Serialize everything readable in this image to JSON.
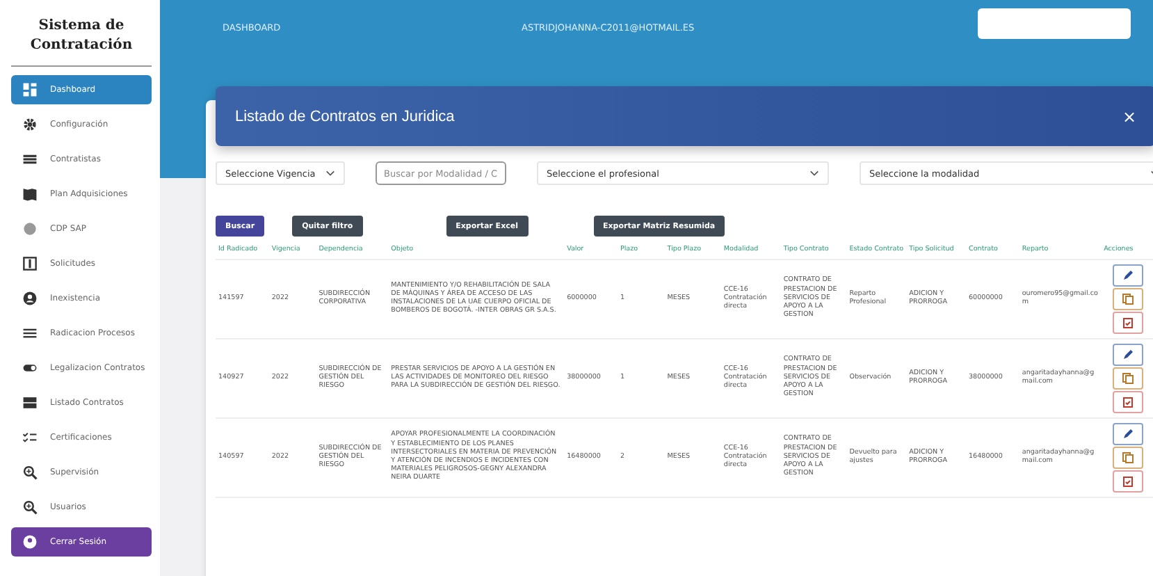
{
  "sidebar": {
    "title": "Sistema de Contratación",
    "items": [
      {
        "label": "Dashboard",
        "kind": "nav",
        "selected": true
      },
      {
        "label": "Configuración",
        "kind": "nav",
        "selected": false
      },
      {
        "label": "Contratistas",
        "kind": "nav",
        "selected": false
      },
      {
        "label": "Plan Adquisiciones",
        "kind": "nav",
        "selected": false
      },
      {
        "label": "CDP SAP",
        "kind": "nav",
        "selected": false
      },
      {
        "label": "Solicitudes",
        "kind": "nav",
        "selected": false
      },
      {
        "label": "Inexistencia",
        "kind": "nav",
        "selected": false
      },
      {
        "label": "Radicacion Procesos",
        "kind": "nav",
        "selected": false
      },
      {
        "label": "Legalizacion Contratos",
        "kind": "nav",
        "selected": false
      },
      {
        "label": "Listado Contratos",
        "kind": "nav",
        "selected": false
      },
      {
        "label": "Certificaciones",
        "kind": "nav",
        "selected": false
      },
      {
        "label": "Supervisión",
        "kind": "nav",
        "selected": false
      },
      {
        "label": "Usuarios",
        "kind": "nav",
        "selected": false
      },
      {
        "label": "Cerrar Sesión",
        "kind": "logout",
        "selected": false
      }
    ]
  },
  "top_bar": {
    "title": "DASHBOARD",
    "user": "ASTRIDJOHANNA-C2011@HOTMAIL.ES"
  },
  "panel": {
    "title": "Listado de Contratos en Juridica",
    "close": "×",
    "filters": {
      "vigencia": "Seleccione Vigencia",
      "search_placeholder": "Buscar por Modalidad / C",
      "profesional": "Seleccione el profesional",
      "modalidad": "Seleccione la modalidad"
    },
    "buttons": [
      {
        "label": "Buscar",
        "kind": "primary"
      },
      {
        "label": "Quitar filtro",
        "kind": "dark"
      },
      {
        "label": "Exportar Excel",
        "kind": "dark"
      },
      {
        "label": "Exportar Matriz Resumida",
        "kind": "dark"
      }
    ],
    "table": {
      "columns": [
        "Id Radicado",
        "Vigencia",
        "Dependencia",
        "Objeto",
        "Valor",
        "Plazo",
        "Tipo Plazo",
        "Modalidad",
        "Tipo Contrato",
        "Estado Contrato",
        "Tipo Solicitud",
        "Contrato",
        "Reparto",
        "Acciones"
      ],
      "rows": [
        {
          "cells": [
            "141597",
            "2022",
            "SUBDIRECCIÓN CORPORATIVA",
            "MANTENIMIENTO Y/O REHABILITACIÓN DE SALA DE MÁQUINAS Y ÁREA DE ACCESO DE LAS INSTALACIONES DE LA UAE CUERPO OFICIAL DE BOMBEROS DE BOGOTÁ. -INTER OBRAS GR S.A.S.",
            "6000000",
            "1",
            "MESES",
            "CCE-16 Contratación directa",
            "CONTRATO DE PRESTACION DE SERVICIOS DE APOYO A LA GESTION",
            "Reparto Profesional",
            "ADICION Y PRORROGA",
            "60000000",
            "ouromero95@gmail.com"
          ]
        },
        {
          "cells": [
            "140927",
            "2022",
            "SUBDIRECCIÓN DE GESTIÓN DEL RIESGO",
            "PRESTAR SERVICIOS DE APOYO A LA GESTIÓN EN LAS ACTIVIDADES DE MONITOREO DEL RIESGO PARA LA SUBDIRECCIÓN DE GESTIÓN DEL RIESGO.",
            "38000000",
            "1",
            "MESES",
            "CCE-16 Contratación directa",
            "CONTRATO DE PRESTACION DE SERVICIOS DE APOYO A LA GESTION",
            "Observación",
            "ADICION Y PRORROGA",
            "38000000",
            "angaritadayhanna@gmail.com"
          ]
        },
        {
          "cells": [
            "140597",
            "2022",
            "SUBDIRECCIÓN DE GESTIÓN DEL RIESGO",
            "APOYAR PROFESIONALMENTE LA COORDINACIÓN Y ESTABLECIMIENTO DE LOS PLANES INTERSECTORIALES EN MATERIA DE PREVENCIÓN Y ATENCIÓN DE INCENDIOS E INCIDENTES CON MATERIALES PELIGROSOS-GEGNY ALEXANDRA NEIRA DUARTE",
            "16480000",
            "2",
            "MESES",
            "CCE-16 Contratación directa",
            "CONTRATO DE PRESTACION DE SERVICIOS DE APOYO A LA GESTION",
            "Devuelto para ajustes",
            "ADICION Y PRORROGA",
            "16480000",
            "angaritadayhanna@gmail.com"
          ]
        }
      ]
    }
  }
}
